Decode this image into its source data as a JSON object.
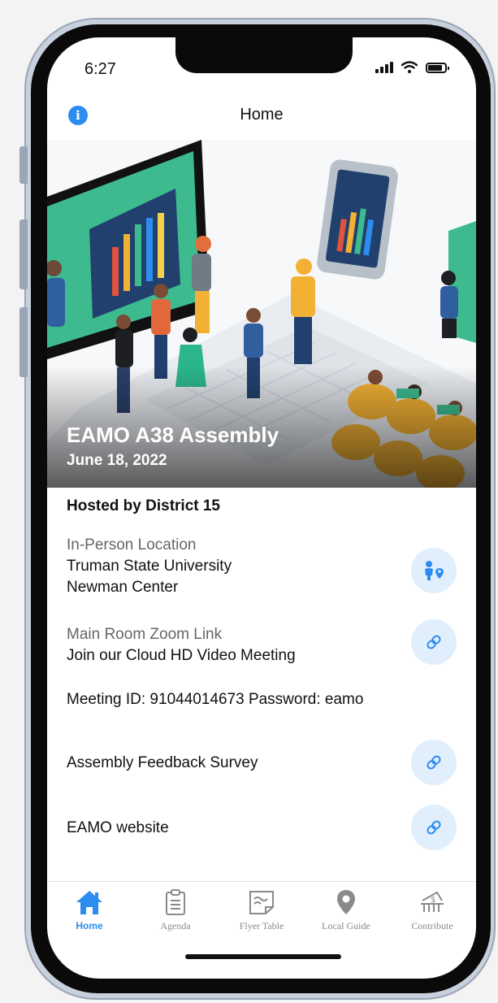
{
  "status_bar": {
    "time": "6:27"
  },
  "header": {
    "title": "Home",
    "info_icon": "info-icon"
  },
  "hero": {
    "title": "EAMO A38 Assembly",
    "date": "June 18, 2022"
  },
  "event": {
    "hosted_by": "Hosted by District 15",
    "location_label": "In-Person Location",
    "location_line1": "Truman State University",
    "location_line2": "Newman Center",
    "zoom_label": "Main Room Zoom Link",
    "zoom_link_text": "Join our Cloud HD Video Meeting",
    "meeting_info": "Meeting ID: 91044014673 Password: eamo",
    "survey_link_text": "Assembly Feedback Survey",
    "website_link_text": "EAMO website"
  },
  "tabs": [
    {
      "label": "Home",
      "icon": "home-icon",
      "active": true
    },
    {
      "label": "Agenda",
      "icon": "clipboard-icon",
      "active": false
    },
    {
      "label": "Flyer Table",
      "icon": "flyer-icon",
      "active": false
    },
    {
      "label": "Local Guide",
      "icon": "map-pin-icon",
      "active": false
    },
    {
      "label": "Contribute",
      "icon": "donate-icon",
      "active": false
    }
  ],
  "colors": {
    "accent": "#2d8cf0",
    "icon_bg": "#e1effd",
    "inactive": "#8a8a8a"
  }
}
